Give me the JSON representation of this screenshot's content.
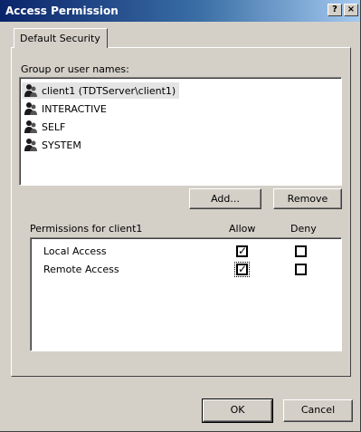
{
  "window": {
    "title": "Access Permission",
    "help_label": "?",
    "close_label": "×"
  },
  "tab": {
    "label": "Default Security"
  },
  "group_label": "Group or user names:",
  "users": [
    {
      "label": "client1 (TDTServer\\client1)",
      "selected": true
    },
    {
      "label": "INTERACTIVE",
      "selected": false
    },
    {
      "label": "SELF",
      "selected": false
    },
    {
      "label": "SYSTEM",
      "selected": false
    }
  ],
  "buttons": {
    "add": "Add...",
    "remove": "Remove",
    "ok": "OK",
    "cancel": "Cancel"
  },
  "permissions": {
    "label": "Permissions for client1",
    "allow_header": "Allow",
    "deny_header": "Deny",
    "rows": [
      {
        "name": "Local Access",
        "allow": true,
        "deny": false
      },
      {
        "name": "Remote Access",
        "allow": true,
        "deny": false
      }
    ]
  },
  "icons": {
    "user": "group-user-icon",
    "check": "check-mark-icon"
  },
  "colors": {
    "title_start": "#0a246a",
    "title_end": "#a6caf0",
    "face": "#d4d0c8",
    "selected_row": "#e4e4e4"
  }
}
